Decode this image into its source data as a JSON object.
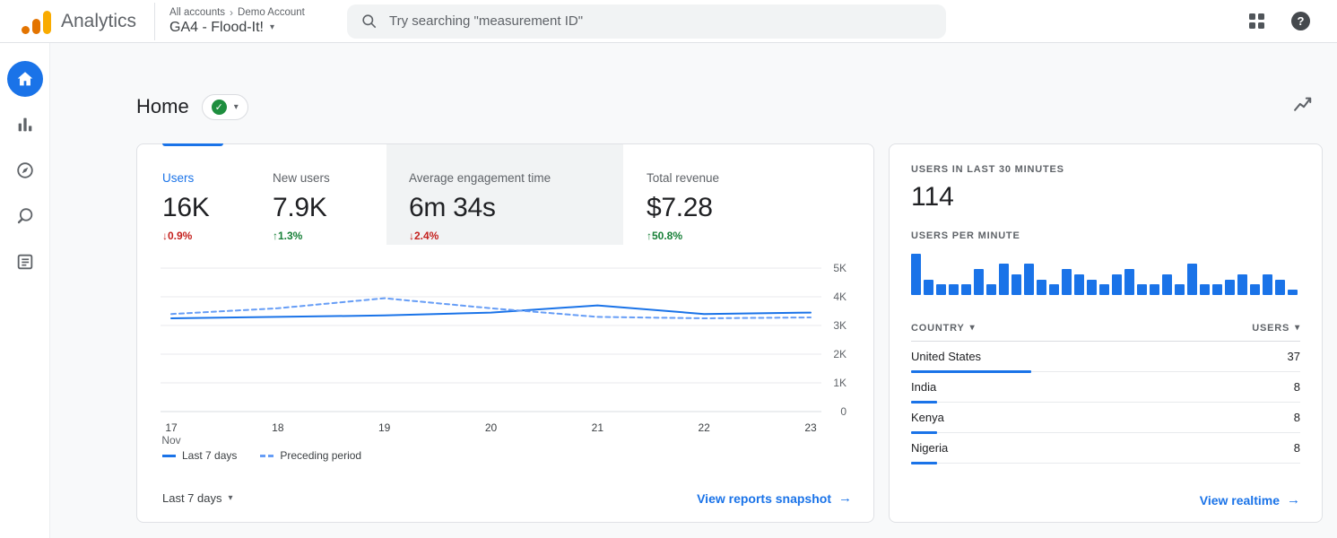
{
  "icons": {
    "caret_down": "▾",
    "arrow_right": "→",
    "check": "✓",
    "breadcrumb_sep": "›",
    "help": "?"
  },
  "header": {
    "app_name": "Analytics",
    "breadcrumb": [
      "All accounts",
      "Demo Account"
    ],
    "property": "GA4 - Flood-It!",
    "search_placeholder": "Try searching \"measurement ID\""
  },
  "page": {
    "title": "Home"
  },
  "overview_card": {
    "metrics": [
      {
        "label": "Users",
        "value": "16K",
        "delta": "0.9%",
        "direction": "down",
        "active": true,
        "highlighted": false
      },
      {
        "label": "New users",
        "value": "7.9K",
        "delta": "1.3%",
        "direction": "up",
        "active": false,
        "highlighted": false
      },
      {
        "label": "Average engagement time",
        "value": "6m 34s",
        "delta": "2.4%",
        "direction": "down",
        "active": false,
        "highlighted": true
      },
      {
        "label": "Total revenue",
        "value": "$7.28",
        "delta": "50.8%",
        "direction": "up",
        "active": false,
        "highlighted": false
      }
    ],
    "legend": [
      {
        "label": "Last 7 days",
        "style": "solid"
      },
      {
        "label": "Preceding period",
        "style": "dashed"
      }
    ],
    "date_range": "Last 7 days",
    "footer_link": "View reports snapshot"
  },
  "chart_data": [
    {
      "type": "line",
      "title": "Users by day (last 7 days vs preceding period)",
      "x": [
        "17 Nov",
        "18",
        "19",
        "20",
        "21",
        "22",
        "23"
      ],
      "series": [
        {
          "name": "Last 7 days",
          "style": "solid",
          "values": [
            3250,
            3300,
            3350,
            3450,
            3700,
            3400,
            3450
          ]
        },
        {
          "name": "Preceding period",
          "style": "dashed",
          "values": [
            3400,
            3600,
            3950,
            3600,
            3300,
            3250,
            3280
          ]
        }
      ],
      "ylim": [
        0,
        5000
      ],
      "yticks": [
        "5K",
        "4K",
        "3K",
        "2K",
        "1K",
        "0"
      ],
      "grid": true,
      "legend_position": "bottom-left"
    },
    {
      "type": "bar",
      "title": "Users per minute",
      "values": [
        8,
        3,
        2,
        2,
        2,
        5,
        2,
        6,
        4,
        6,
        3,
        2,
        5,
        4,
        3,
        2,
        4,
        5,
        2,
        2,
        4,
        2,
        6,
        2,
        2,
        3,
        4,
        2,
        4,
        3,
        1
      ],
      "ylim": [
        0,
        8
      ]
    }
  ],
  "realtime_card": {
    "users_30min_label": "USERS IN LAST 30 MINUTES",
    "users_30min_value": "114",
    "per_minute_label": "USERS PER MINUTE",
    "table": {
      "country_header": "COUNTRY",
      "users_header": "USERS",
      "rows": [
        {
          "country": "United States",
          "users": 37
        },
        {
          "country": "India",
          "users": 8
        },
        {
          "country": "Kenya",
          "users": 8
        },
        {
          "country": "Nigeria",
          "users": 8
        }
      ]
    },
    "footer_link": "View realtime"
  },
  "colors": {
    "accent_blue": "#1a73e8",
    "dashed_blue": "#669df6",
    "negative_red": "#c5221f",
    "positive_green": "#188038",
    "logo_yellow": "#f9ab00",
    "logo_orange": "#e37400"
  }
}
